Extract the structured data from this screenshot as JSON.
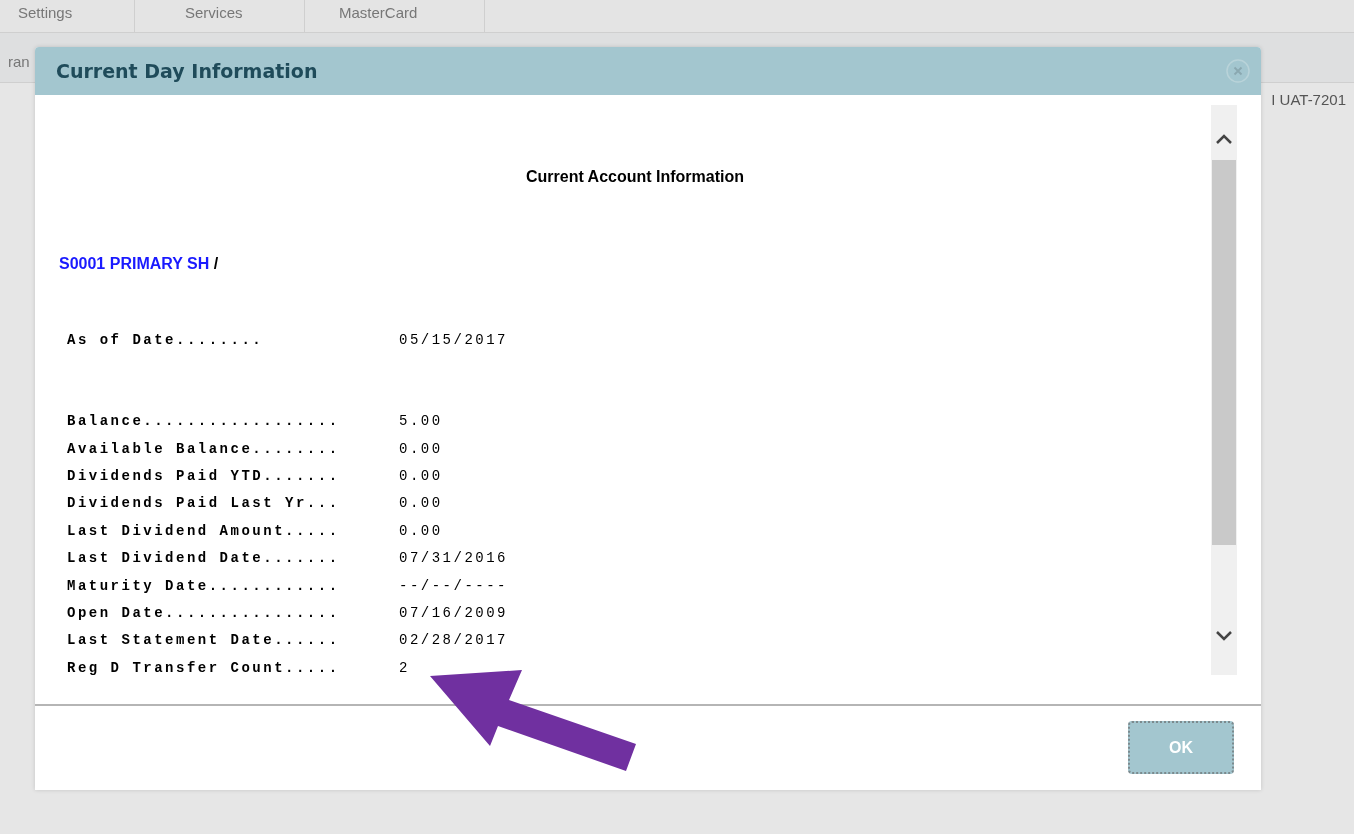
{
  "background": {
    "tabs": [
      {
        "label": "Settings",
        "selected": false
      },
      {
        "label": "Services",
        "selected": false
      },
      {
        "label": "MasterCard",
        "selected": false
      }
    ],
    "subtab_fragment": "ran",
    "right_label": "I UAT-7201"
  },
  "dialog": {
    "title": "Current Day Information",
    "heading": "Current Account Information",
    "account": {
      "link": "S0001 PRIMARY SH",
      "suffix": " /"
    },
    "as_of": {
      "label": "As of Date........",
      "value": "05/15/2017"
    },
    "rows": [
      {
        "label": "Balance..................",
        "value": "5.00"
      },
      {
        "label": "Available Balance........",
        "value": "0.00"
      },
      {
        "label": "Dividends Paid YTD.......",
        "value": "0.00"
      },
      {
        "label": "Dividends Paid Last Yr...",
        "value": "0.00"
      },
      {
        "label": "Last Dividend Amount.....",
        "value": "0.00"
      },
      {
        "label": "Last Dividend Date.......",
        "value": "07/31/2016"
      },
      {
        "label": "Maturity Date............",
        "value": "--/--/----"
      },
      {
        "label": "Open Date................",
        "value": "07/16/2009"
      },
      {
        "label": "Last Statement Date......",
        "value": "02/28/2017"
      },
      {
        "label": "Reg D Transfer Count.....",
        "value": "2"
      }
    ],
    "ok_button": "OK"
  }
}
